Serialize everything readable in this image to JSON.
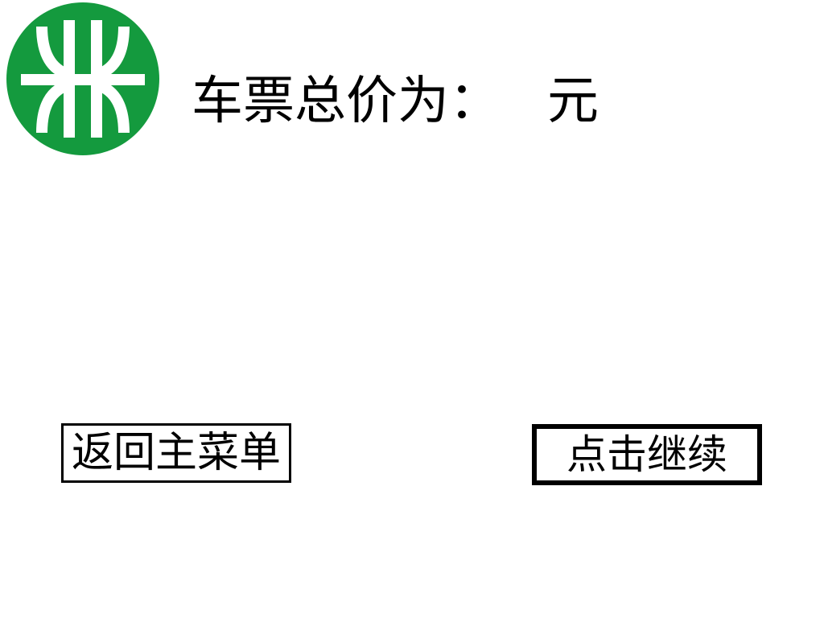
{
  "brand": {
    "logo_icon": "metro-logo-icon",
    "logo_color": "#149a3e",
    "logo_mark_color": "#ffffff"
  },
  "fare": {
    "label": "车票总价为：",
    "value": "",
    "unit": "元"
  },
  "buttons": {
    "back_label": "返回主菜单",
    "continue_label": "点击继续"
  }
}
